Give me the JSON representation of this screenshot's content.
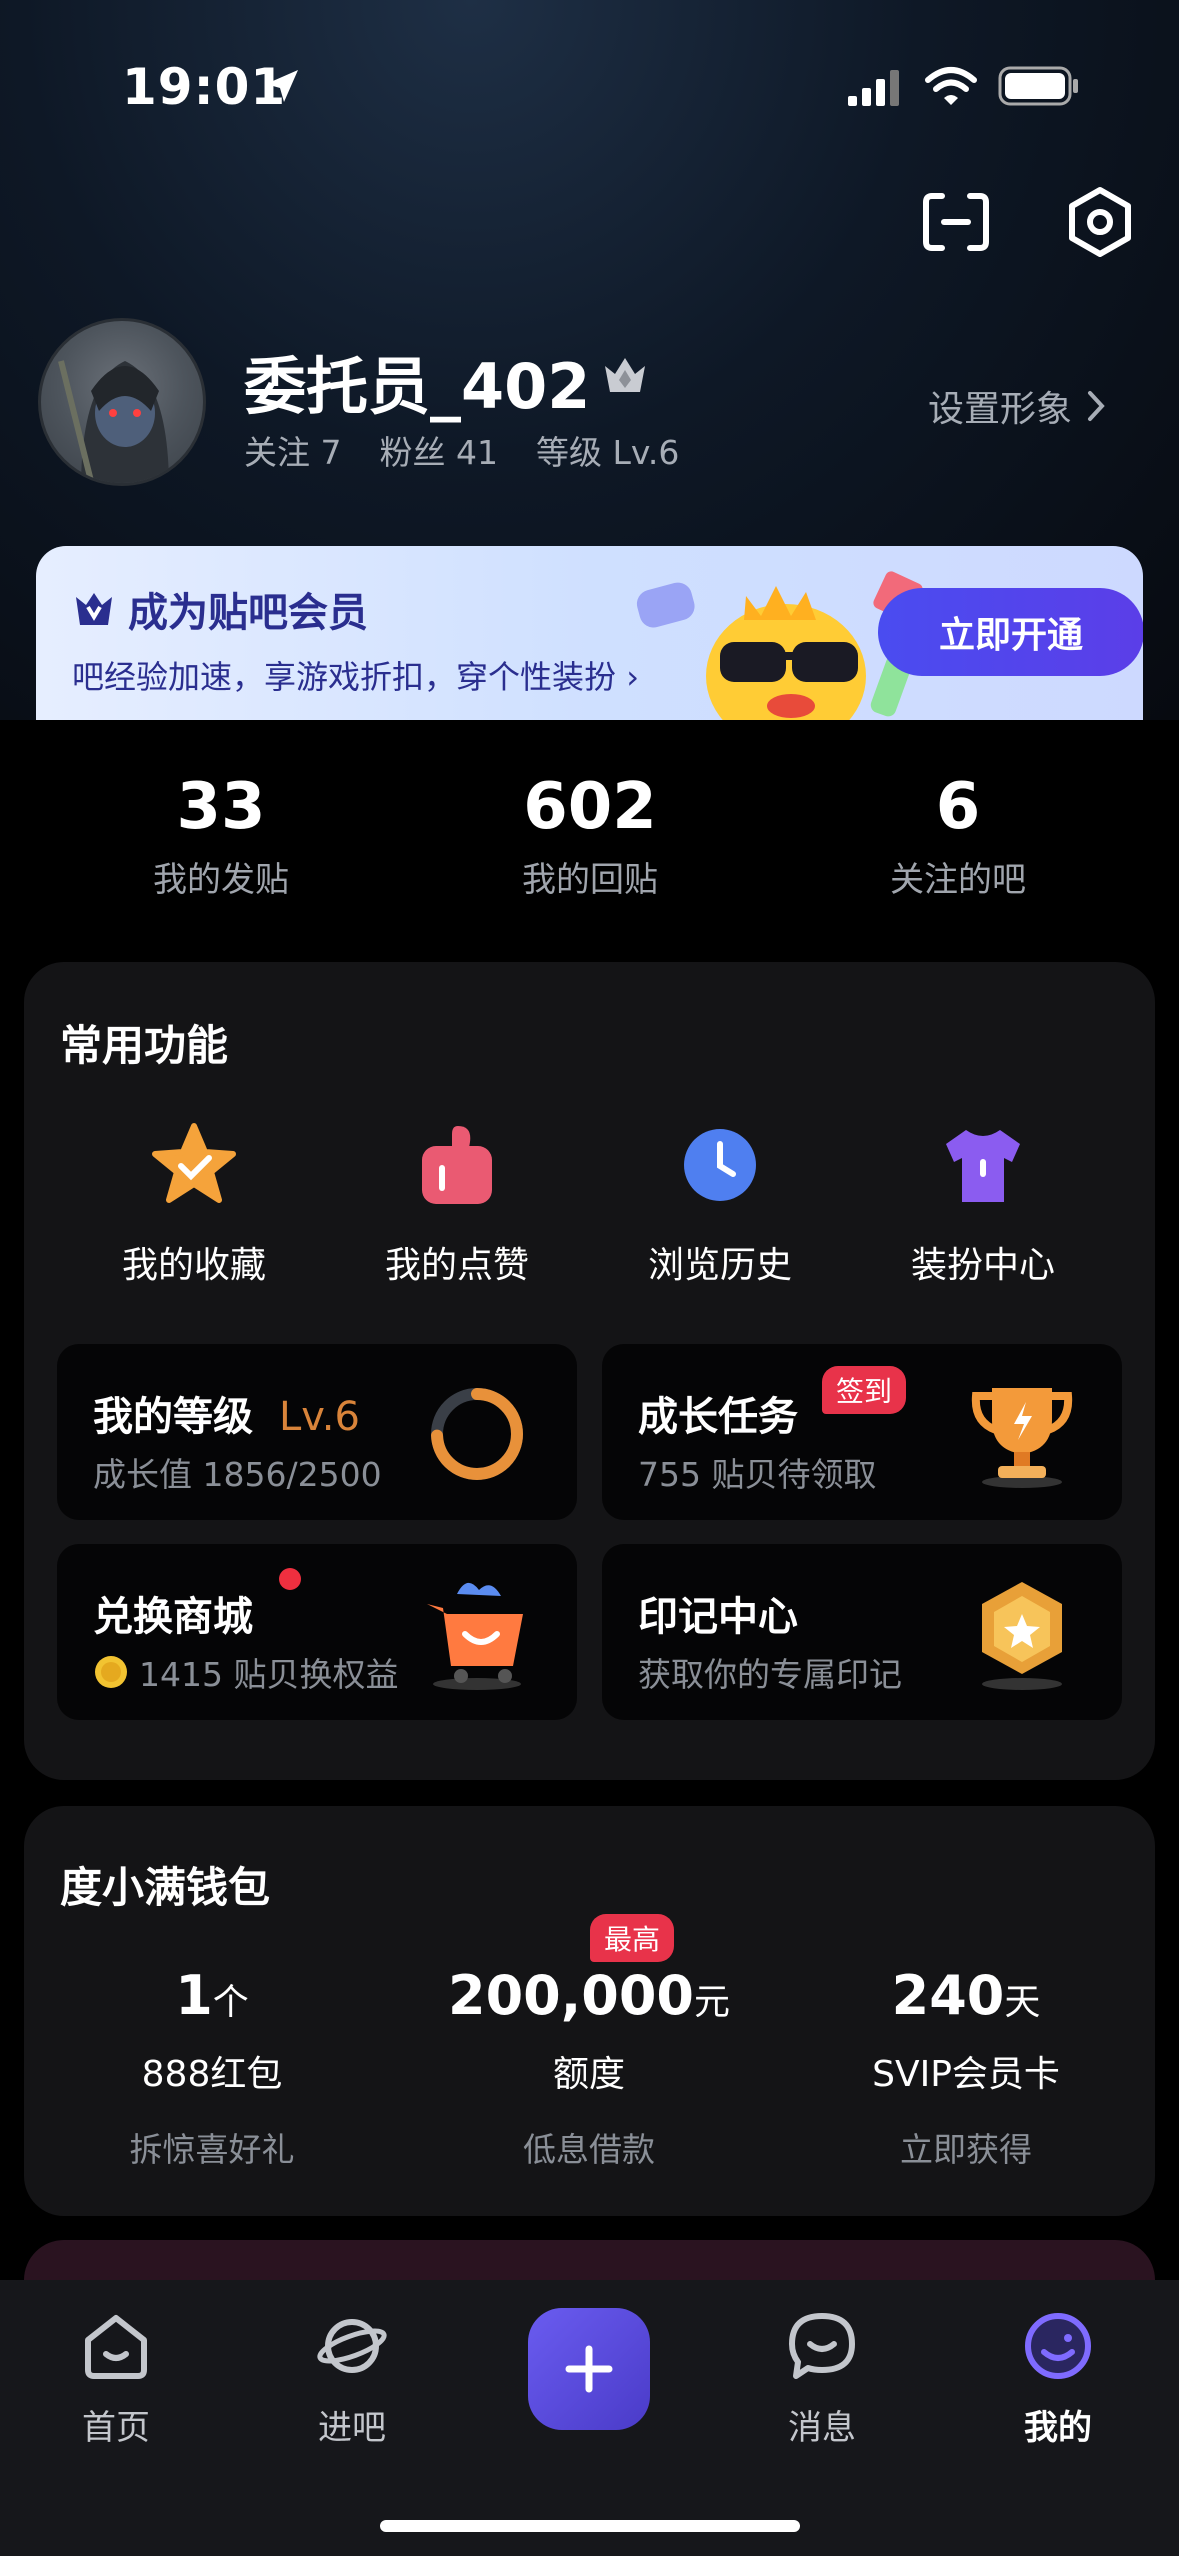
{
  "status_bar": {
    "time": "19:01"
  },
  "profile": {
    "username": "委托员_402",
    "following": "关注 7",
    "fans": "粉丝 41",
    "level": "等级 Lv.6",
    "set_image": "设置形象"
  },
  "vip_banner": {
    "title": "成为贴吧会员",
    "subtitle": "吧经验加速，享游戏折扣，穿个性装扮",
    "button": "立即开通"
  },
  "counts": [
    {
      "value": "33",
      "label": "我的发贴"
    },
    {
      "value": "602",
      "label": "我的回贴"
    },
    {
      "value": "6",
      "label": "关注的吧"
    }
  ],
  "common_functions": {
    "title": "常用功能",
    "items": [
      {
        "label": "我的收藏",
        "icon": "star-icon"
      },
      {
        "label": "我的点赞",
        "icon": "thumbs-up-icon"
      },
      {
        "label": "浏览历史",
        "icon": "clock-icon"
      },
      {
        "label": "装扮中心",
        "icon": "shirt-icon"
      }
    ],
    "tiles": {
      "level": {
        "title": "我的等级",
        "level": "Lv.6",
        "sub": "成长值 1856/2500",
        "progress": 0.7424
      },
      "tasks": {
        "title": "成长任务",
        "badge": "签到",
        "sub": "755 贴贝待领取"
      },
      "mall": {
        "title": "兑换商城",
        "sub": "1415  贴贝换权益"
      },
      "marks": {
        "title": "印记中心",
        "sub": "获取你的专属印记"
      }
    }
  },
  "wallet": {
    "title": "度小满钱包",
    "badge": "最高",
    "items": [
      {
        "value": "1",
        "unit": "个",
        "name": "888红包",
        "sub": "拆惊喜好礼"
      },
      {
        "value": "200,000",
        "unit": "元",
        "name": "额度",
        "sub": "低息借款"
      },
      {
        "value": "240",
        "unit": "天",
        "name": "SVIP会员卡",
        "sub": "立即获得"
      }
    ]
  },
  "nav": {
    "items": [
      {
        "label": "首页"
      },
      {
        "label": "进吧"
      },
      {
        "label": "消息"
      },
      {
        "label": "我的"
      }
    ]
  },
  "colors": {
    "accent": "#5b3ee8",
    "level_orange": "#d9843a",
    "badge_red": "#e8334a"
  }
}
